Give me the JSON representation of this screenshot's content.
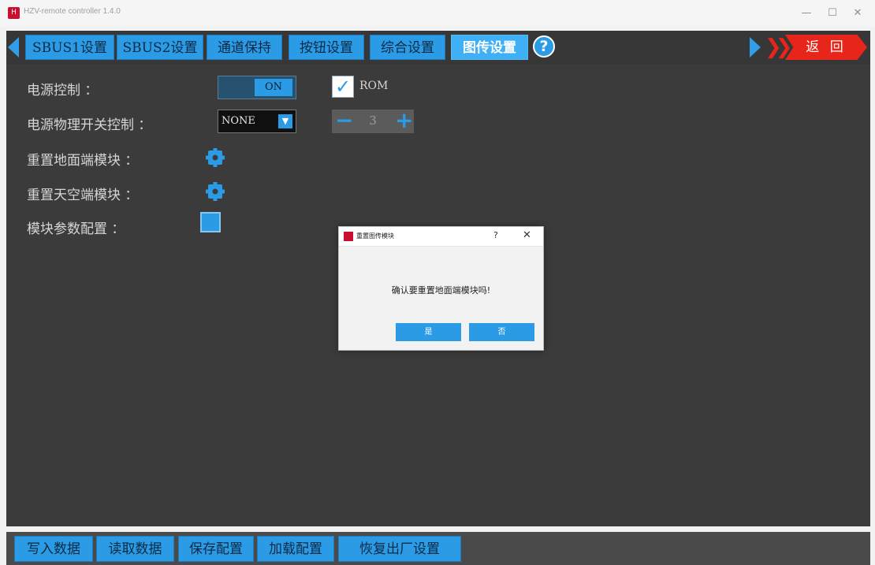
{
  "window": {
    "title": "HZV-remote controller 1.4.0",
    "minimize": "—",
    "maximize": "☐",
    "close": "✕"
  },
  "tabs": [
    {
      "label": "SBUS1设置"
    },
    {
      "label": "SBUS2设置"
    },
    {
      "label": "通道保持"
    },
    {
      "label": "按钮设置"
    },
    {
      "label": "综合设置"
    },
    {
      "label": "图传设置",
      "active": true
    }
  ],
  "help_label": "?",
  "back_label": "返 回",
  "settings": {
    "power_control": {
      "label": "电源控制 ：",
      "toggle_value": "ON",
      "checkbox_label": "ROM",
      "checked": true
    },
    "power_switch": {
      "label": "电源物理开关控制 ：",
      "select_value": "NONE",
      "stepper_value": "3"
    },
    "reset_ground": {
      "label": "重置地面端模块 ："
    },
    "reset_air": {
      "label": "重置天空端模块 ："
    },
    "module_config": {
      "label": "模块参数配置 ："
    }
  },
  "dialog": {
    "title": "重置图传模块",
    "help": "?",
    "close": "✕",
    "message": "确认要重置地面端模块吗!",
    "yes": "是",
    "no": "否"
  },
  "bottom_buttons": [
    {
      "label": "写入数据"
    },
    {
      "label": "读取数据"
    },
    {
      "label": "保存配置"
    },
    {
      "label": "加载配置"
    },
    {
      "label": "恢复出厂设置"
    }
  ],
  "colors": {
    "accent_blue": "#2b9be6",
    "back_red": "#e8251b",
    "panel_dark": "#3b3b3b"
  }
}
